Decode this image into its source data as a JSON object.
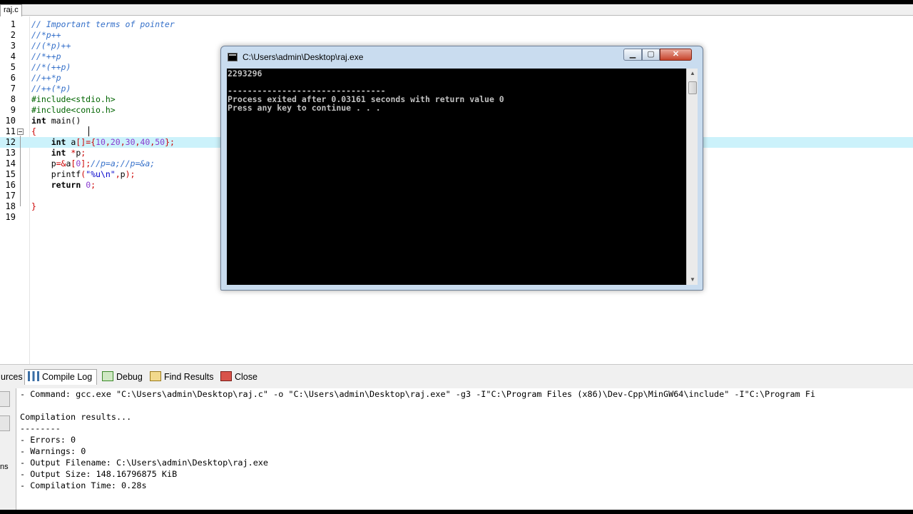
{
  "file_tab": {
    "label": "raj.c"
  },
  "editor": {
    "lines": [
      {
        "n": "1",
        "segments": [
          {
            "t": "// Important terms of pointer",
            "c": "cmt"
          }
        ]
      },
      {
        "n": "2",
        "segments": [
          {
            "t": "//*p++",
            "c": "cmt"
          }
        ]
      },
      {
        "n": "3",
        "segments": [
          {
            "t": "//(*p)++",
            "c": "cmt"
          }
        ]
      },
      {
        "n": "4",
        "segments": [
          {
            "t": "//*++p",
            "c": "cmt"
          }
        ]
      },
      {
        "n": "5",
        "segments": [
          {
            "t": "//*(++p)",
            "c": "cmt"
          }
        ]
      },
      {
        "n": "6",
        "segments": [
          {
            "t": "//++*p",
            "c": "cmt"
          }
        ]
      },
      {
        "n": "7",
        "segments": [
          {
            "t": "//++(*p)",
            "c": "cmt"
          }
        ]
      },
      {
        "n": "8",
        "segments": [
          {
            "t": "#include<stdio.h>",
            "c": "pre"
          }
        ]
      },
      {
        "n": "9",
        "segments": [
          {
            "t": "#include<conio.h>",
            "c": "pre"
          }
        ]
      },
      {
        "n": "10",
        "segments": [
          {
            "t": "int",
            "c": "kw"
          },
          {
            "t": " main()",
            "c": ""
          }
        ]
      },
      {
        "n": "11",
        "segments": [
          {
            "t": "{",
            "c": "sym"
          }
        ]
      },
      {
        "n": "12",
        "segments": [
          {
            "t": "    ",
            "c": ""
          },
          {
            "t": "int",
            "c": "kw"
          },
          {
            "t": " a",
            "c": ""
          },
          {
            "t": "[]={",
            "c": "sym"
          },
          {
            "t": "10",
            "c": "num"
          },
          {
            "t": ",",
            "c": "sym"
          },
          {
            "t": "20",
            "c": "num"
          },
          {
            "t": ",",
            "c": "sym"
          },
          {
            "t": "30",
            "c": "num"
          },
          {
            "t": ",",
            "c": "sym"
          },
          {
            "t": "40",
            "c": "num"
          },
          {
            "t": ",",
            "c": "sym"
          },
          {
            "t": "50",
            "c": "num"
          },
          {
            "t": "};",
            "c": "sym"
          }
        ]
      },
      {
        "n": "13",
        "segments": [
          {
            "t": "    ",
            "c": ""
          },
          {
            "t": "int",
            "c": "kw"
          },
          {
            "t": " ",
            "c": ""
          },
          {
            "t": "*",
            "c": "sym"
          },
          {
            "t": "p",
            "c": ""
          },
          {
            "t": ";",
            "c": "sym"
          }
        ]
      },
      {
        "n": "14",
        "segments": [
          {
            "t": "    p",
            "c": ""
          },
          {
            "t": "=&",
            "c": "sym"
          },
          {
            "t": "a",
            "c": ""
          },
          {
            "t": "[",
            "c": "sym"
          },
          {
            "t": "0",
            "c": "num"
          },
          {
            "t": "];",
            "c": "sym"
          },
          {
            "t": "//p=a;//p=&a;",
            "c": "cmt"
          }
        ]
      },
      {
        "n": "15",
        "segments": [
          {
            "t": "    printf",
            "c": ""
          },
          {
            "t": "(",
            "c": "sym"
          },
          {
            "t": "\"%u\\n\"",
            "c": "str"
          },
          {
            "t": ",",
            "c": "sym"
          },
          {
            "t": "p",
            "c": ""
          },
          {
            "t": ");",
            "c": "sym"
          }
        ]
      },
      {
        "n": "16",
        "segments": [
          {
            "t": "    ",
            "c": ""
          },
          {
            "t": "return",
            "c": "kw"
          },
          {
            "t": " ",
            "c": ""
          },
          {
            "t": "0",
            "c": "num"
          },
          {
            "t": ";",
            "c": "sym"
          }
        ]
      },
      {
        "n": "17",
        "segments": []
      },
      {
        "n": "18",
        "segments": [
          {
            "t": "}",
            "c": "sym"
          }
        ]
      },
      {
        "n": "19",
        "segments": []
      }
    ],
    "highlighted_line": "12"
  },
  "console": {
    "title": "C:\\Users\\admin\\Desktop\\raj.exe",
    "min_glyph": "▁",
    "max_glyph": "▢",
    "close_glyph": "✕",
    "scroll_up": "▲",
    "scroll_down": "▼",
    "output": "2293296\n\n--------------------------------\nProcess exited after 0.03161 seconds with return value 0\nPress any key to continue . . ."
  },
  "bottom_panel": {
    "tabs": [
      {
        "label": "urces",
        "icon": "none"
      },
      {
        "label": "Compile Log",
        "icon": "compile-log-icon",
        "active": true
      },
      {
        "label": "Debug",
        "icon": "debug-icon"
      },
      {
        "label": "Find Results",
        "icon": "find-results-icon"
      },
      {
        "label": "Close",
        "icon": "close-icon"
      }
    ],
    "left_stub_text": "ns",
    "log": [
      "- Command: gcc.exe \"C:\\Users\\admin\\Desktop\\raj.c\" -o \"C:\\Users\\admin\\Desktop\\raj.exe\" -g3 -I\"C:\\Program Files (x86)\\Dev-Cpp\\MinGW64\\include\" -I\"C:\\Program Fi",
      "",
      "Compilation results...",
      "--------",
      "- Errors: 0",
      "- Warnings: 0",
      "- Output Filename: C:\\Users\\admin\\Desktop\\raj.exe",
      "- Output Size: 148.16796875 KiB",
      "- Compilation Time: 0.28s"
    ]
  }
}
